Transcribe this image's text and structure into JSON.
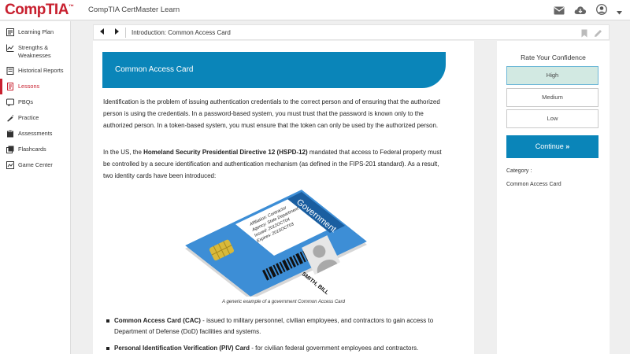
{
  "header": {
    "logo_text": "CompTIA",
    "logo_mark": "™",
    "app_title": "CompTIA CertMaster Learn",
    "icons": [
      "mail-icon",
      "cloud-download-icon",
      "user-icon",
      "chevron-down-icon"
    ],
    "brand_color": "#c8202f"
  },
  "sidebar": {
    "items": [
      {
        "label": "Learning Plan",
        "icon": "learning-plan-icon"
      },
      {
        "label": "Strengths & Weaknesses",
        "icon": "strengths-icon"
      },
      {
        "label": "Historical Reports",
        "icon": "reports-icon"
      },
      {
        "label": "Lessons",
        "icon": "lessons-icon",
        "active": true
      },
      {
        "label": "PBQs",
        "icon": "pbqs-icon"
      },
      {
        "label": "Practice",
        "icon": "practice-icon"
      },
      {
        "label": "Assessments",
        "icon": "assessments-icon"
      },
      {
        "label": "Flashcards",
        "icon": "flashcards-icon"
      },
      {
        "label": "Game Center",
        "icon": "game-center-icon"
      }
    ]
  },
  "toolbar": {
    "title": "Introduction: Common Access Card",
    "icons": [
      "previous-icon",
      "next-icon",
      "bookmark-icon",
      "pencil-icon"
    ]
  },
  "content": {
    "banner_title": "Common Access Card",
    "accent_color": "#0a85b9",
    "para1": "Identification is the problem of issuing authentication credentials to the correct person and of ensuring that the authorized person is using the credentials. In a password-based system, you must trust that the password is known only to the authorized person. In a token-based system, you must ensure that the token can only be used by the authorized person.",
    "para2_pre": "In the US, the ",
    "para2_bold": "Homeland Security Presidential Directive 12 (HSPD-12)",
    "para2_post": " mandated that access to Federal property must be controlled by a secure identification and authentication mechanism (as defined in the FIPS-201 standard). As a result, two identity cards have been introduced:",
    "card": {
      "header": "Government",
      "line1": "Affiliation: Contractor",
      "line2": "Agency: State Department",
      "line3": "Issued: 2012OCT04",
      "line4": "Expires: 2015OCT03",
      "name": "SMITH, BILL"
    },
    "caption": "A generic example of a government Common Access Card",
    "bullets": [
      {
        "bold": "Common Access Card (CAC)",
        "text": " - issued to military personnel, civilian employees, and contractors to gain access to Department of Defense (DoD) facilities and systems."
      },
      {
        "bold": "Personal Identification Verification (PIV) Card",
        "text": " - for civilian federal government employees and contractors."
      }
    ]
  },
  "right_panel": {
    "rate_title": "Rate Your Confidence",
    "options": [
      {
        "label": "High",
        "selected": true
      },
      {
        "label": "Medium",
        "selected": false
      },
      {
        "label": "Low",
        "selected": false
      }
    ],
    "continue_label": "Continue",
    "continue_glyph": "»",
    "category_label": "Category :",
    "category_value": "Common Access Card"
  }
}
